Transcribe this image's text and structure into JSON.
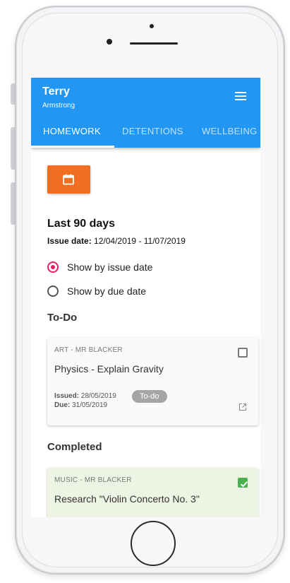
{
  "header": {
    "first_name": "Terry",
    "last_name": "Armstrong"
  },
  "tabs": [
    {
      "label": "HOMEWORK",
      "active": true
    },
    {
      "label": "DETENTIONS",
      "active": false
    },
    {
      "label": "WELLBEING",
      "active": false
    }
  ],
  "icons": {
    "menu": "menu-icon",
    "calendar": "calendar-icon",
    "open_external": "open-external-icon",
    "check": "check-icon"
  },
  "colors": {
    "app_bar": "#2196f3",
    "calendar_button": "#f26f21",
    "radio_selected": "#e91e63",
    "completed_check": "#4caf50",
    "completed_card": "#eef4e3"
  },
  "filter": {
    "range_title": "Last 90 days",
    "issue_label": "Issue date:",
    "issue_range": "12/04/2019 - 11/07/2019",
    "options": [
      {
        "label": "Show by issue date",
        "selected": true
      },
      {
        "label": "Show by due date",
        "selected": false
      }
    ]
  },
  "sections": {
    "todo_title": "To-Do",
    "completed_title": "Completed"
  },
  "todo_items": [
    {
      "subject": "ART - MR BLACKER",
      "title": "Physics - Explain Gravity",
      "issued_label": "Issued:",
      "issued": "28/05/2019",
      "due_label": "Due:",
      "due": "31/05/2019",
      "status": "To-do",
      "checked": false
    }
  ],
  "completed_items": [
    {
      "subject": "MUSIC - MR BLACKER",
      "title": "Research \"Violin Concerto No. 3\"",
      "checked": true
    }
  ]
}
